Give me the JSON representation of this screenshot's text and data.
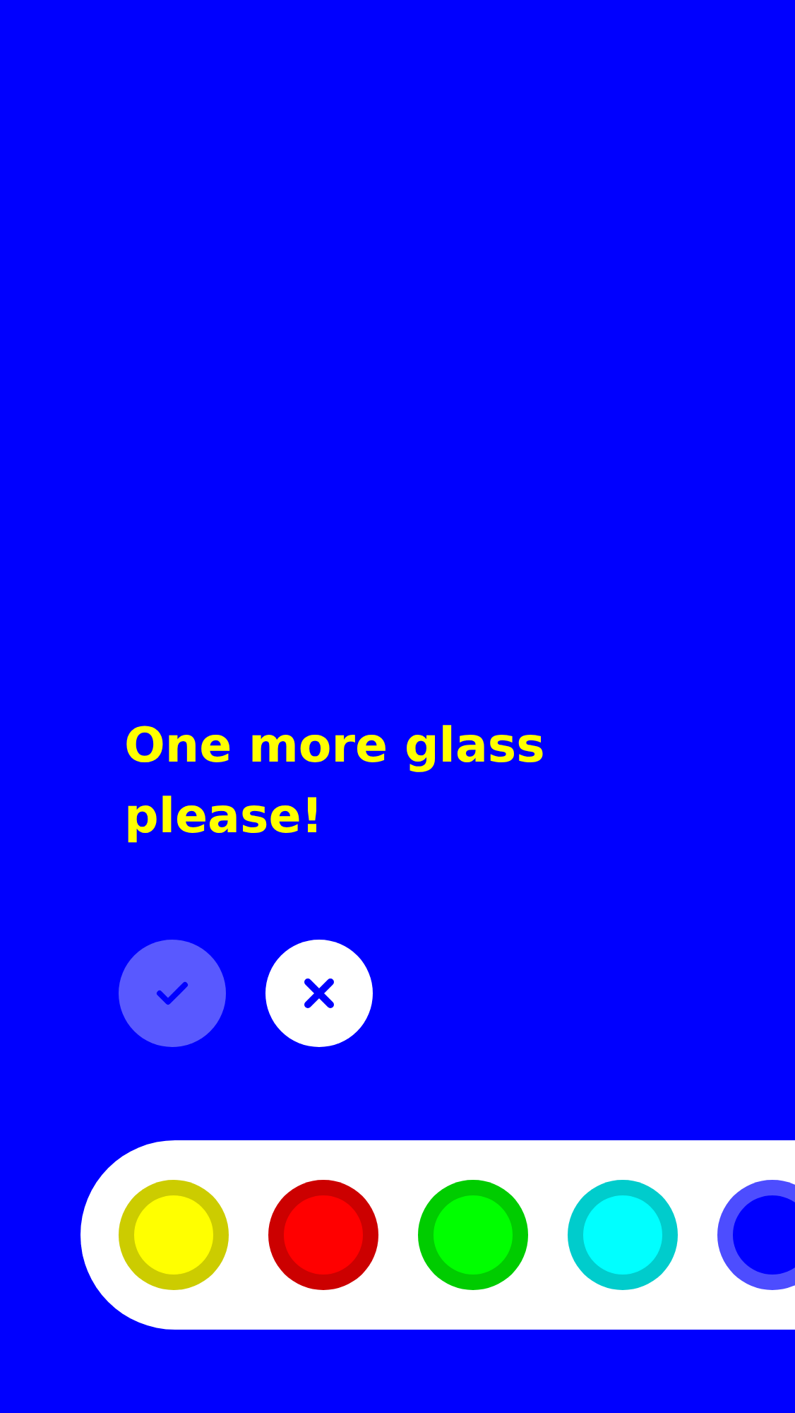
{
  "message": "One more glass please!",
  "actions": [
    {
      "kind": "confirm",
      "disabled": true
    },
    {
      "kind": "cancel",
      "disabled": false
    }
  ],
  "palette": [
    {
      "color": "#ffff00",
      "selected": false
    },
    {
      "color": "#ff0000",
      "selected": false
    },
    {
      "color": "#00ff00",
      "selected": false
    },
    {
      "color": "#00ffff",
      "selected": false
    },
    {
      "color": "#0000ff",
      "selected": true
    }
  ]
}
